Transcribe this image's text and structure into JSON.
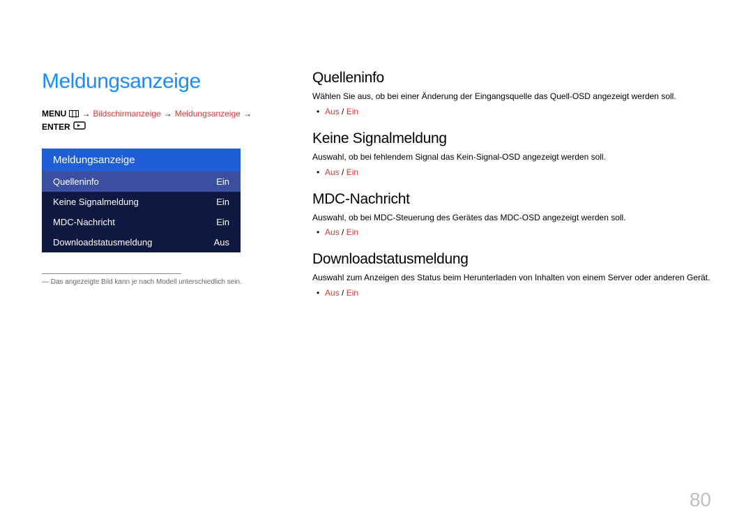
{
  "left": {
    "title": "Meldungsanzeige",
    "breadcrumb": {
      "menu": "MENU",
      "p1": "Bildschirmanzeige",
      "p2": "Meldungsanzeige",
      "enter": "ENTER"
    },
    "osd": {
      "header": "Meldungsanzeige",
      "rows": [
        {
          "label": "Quelleninfo",
          "value": "Ein",
          "selected": true
        },
        {
          "label": "Keine Signalmeldung",
          "value": "Ein",
          "selected": false
        },
        {
          "label": "MDC-Nachricht",
          "value": "Ein",
          "selected": false
        },
        {
          "label": "Downloadstatusmeldung",
          "value": "Aus",
          "selected": false
        }
      ]
    },
    "footnote": "― Das angezeigte Bild kann je nach Modell unterschiedlich sein."
  },
  "right": {
    "sections": [
      {
        "title": "Quelleninfo",
        "desc": "Wählen Sie aus, ob bei einer Änderung der Eingangsquelle das Quell-OSD angezeigt werden soll.",
        "opt_a": "Aus",
        "opt_sep": " / ",
        "opt_b": "Ein"
      },
      {
        "title": "Keine Signalmeldung",
        "desc": "Auswahl, ob bei fehlendem Signal das Kein-Signal-OSD angezeigt werden soll.",
        "opt_a": "Aus",
        "opt_sep": " / ",
        "opt_b": "Ein"
      },
      {
        "title": "MDC-Nachricht",
        "desc": "Auswahl, ob bei MDC-Steuerung des Gerätes das MDC-OSD angezeigt werden soll.",
        "opt_a": "Aus",
        "opt_sep": " / ",
        "opt_b": "Ein"
      },
      {
        "title": "Downloadstatusmeldung",
        "desc": "Auswahl zum Anzeigen des Status beim Herunterladen von Inhalten von einem Server oder anderen Gerät.",
        "opt_a": "Aus",
        "opt_sep": " / ",
        "opt_b": "Ein"
      }
    ]
  },
  "page_number": "80"
}
